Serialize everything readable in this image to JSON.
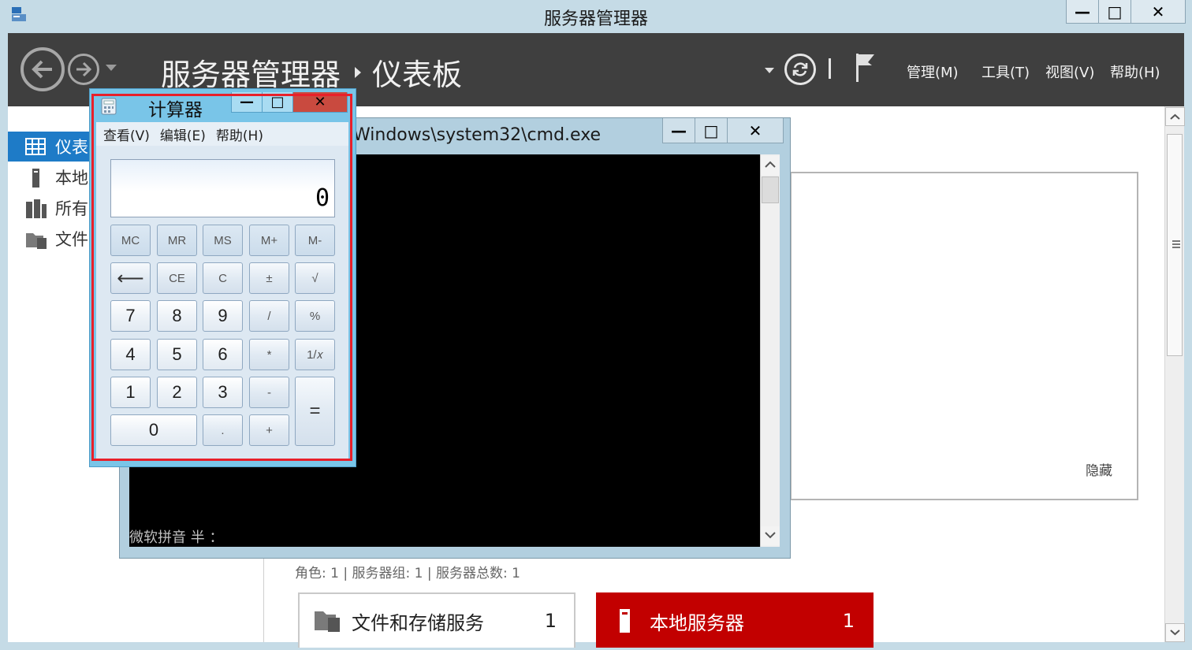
{
  "server_manager": {
    "title": "服务器管理器",
    "breadcrumb": {
      "root": "服务器管理器",
      "current": "仪表板"
    },
    "menu": {
      "manage": "管理(M)",
      "tools": "工具(T)",
      "view": "视图(V)",
      "help": "帮助(H)"
    },
    "sidebar": {
      "items": [
        {
          "label": "仪表",
          "icon": "dashboard-icon",
          "active": true
        },
        {
          "label": "本地",
          "icon": "local-server-icon"
        },
        {
          "label": "所有",
          "icon": "all-servers-icon"
        },
        {
          "label": "文件",
          "icon": "file-storage-icon"
        }
      ]
    },
    "welcome": {
      "hide_label": "隐藏"
    },
    "roles_summary": "角色: 1 | 服务器组: 1 | 服务器总数: 1",
    "tiles": [
      {
        "label": "文件和存储服务",
        "count": "1",
        "icon": "file-storage-icon"
      },
      {
        "label": "本地服务器",
        "count": "1",
        "icon": "local-server-icon",
        "color": "#c20000"
      }
    ]
  },
  "cmd": {
    "title": "Windows\\system32\\cmd.exe",
    "ime_status": "微软拼音 半 ："
  },
  "calculator": {
    "title": "计算器",
    "menu": {
      "view": "查看(V)",
      "edit": "编辑(E)",
      "help": "帮助(H)"
    },
    "display": "0",
    "buttons": {
      "mc": "MC",
      "mr": "MR",
      "ms": "MS",
      "mplus": "M+",
      "mminus": "M-",
      "backspace": "⟵",
      "ce": "CE",
      "c": "C",
      "negate": "±",
      "sqrt": "√",
      "d7": "7",
      "d8": "8",
      "d9": "9",
      "divide": "/",
      "percent": "%",
      "d4": "4",
      "d5": "5",
      "d6": "6",
      "multiply": "*",
      "reciprocal": "1/𝑥",
      "d1": "1",
      "d2": "2",
      "d3": "3",
      "subtract": "-",
      "equals": "=",
      "d0": "0",
      "decimal": ".",
      "add": "+"
    }
  },
  "window_controls": {
    "minimize": "—",
    "maximize": "□",
    "close": "✕"
  },
  "colors": {
    "accent": "#1e7bc7",
    "titlebar": "#c5dbe6",
    "header": "#3f3f3f",
    "local_server_tile": "#c20000",
    "highlight": "#e8202a"
  }
}
